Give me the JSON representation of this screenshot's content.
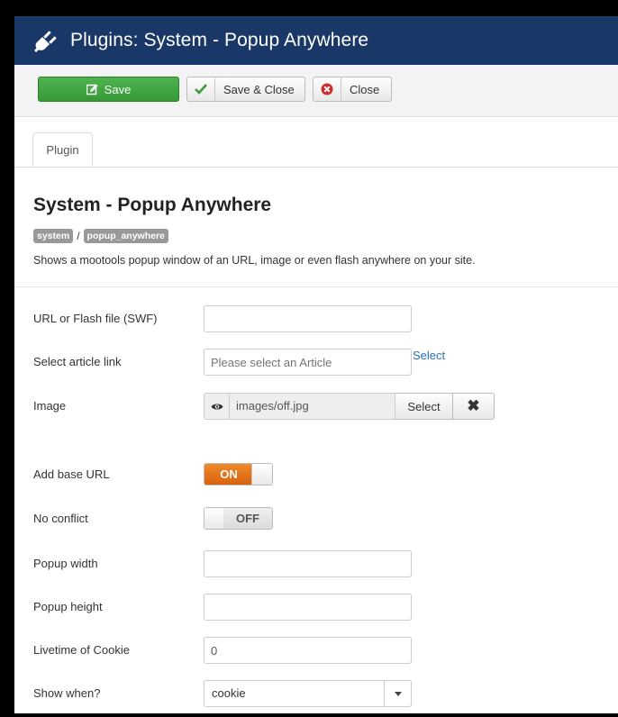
{
  "header": {
    "title": "Plugins: System - Popup Anywhere",
    "icon": "plug-icon"
  },
  "toolbar": {
    "save_label": "Save",
    "save_close_label": "Save & Close",
    "close_label": "Close"
  },
  "tabs": [
    {
      "label": "Plugin"
    }
  ],
  "plugin": {
    "title": "System - Popup Anywhere",
    "tags": [
      "system",
      "popup_anywhere"
    ],
    "tag_separator": "/",
    "description": "Shows a mootools popup window of an URL, image or even flash anywhere on your site."
  },
  "fields": {
    "url_flash": {
      "label": "URL or Flash file (SWF)",
      "value": ""
    },
    "article": {
      "label": "Select article link",
      "placeholder": "Please select an Article",
      "select_label": "Select"
    },
    "image": {
      "label": "Image",
      "value": "images/off.jpg",
      "select_label": "Select",
      "clear_glyph": "✖"
    },
    "add_base_url": {
      "label": "Add base URL",
      "state": "ON"
    },
    "no_conflict": {
      "label": "No conflict",
      "state": "OFF"
    },
    "popup_width": {
      "label": "Popup width",
      "value": ""
    },
    "popup_height": {
      "label": "Popup height",
      "value": ""
    },
    "cookie_lifetime": {
      "label": "Livetime of Cookie",
      "value": "0"
    },
    "show_when": {
      "label": "Show when?",
      "value": "cookie"
    }
  },
  "colors": {
    "header_bg": "#1a3867",
    "save_green": "#3aa23a",
    "toggle_on": "#e0731a",
    "link_blue": "#2a6fbf"
  }
}
